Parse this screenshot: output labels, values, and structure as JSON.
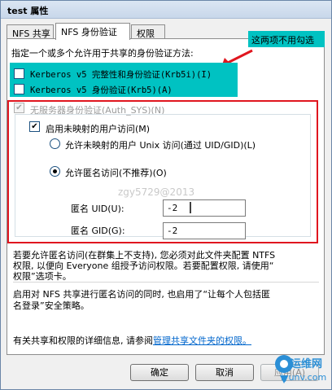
{
  "window": {
    "title": "test 属性"
  },
  "tabs": [
    {
      "label": "NFS 共享"
    },
    {
      "label": "NFS 身份验证"
    },
    {
      "label": "权限"
    }
  ],
  "auth": {
    "intro": "指定一个或多个允许用于共享的身份验证方法:",
    "krb5i_label": "Kerberos v5 完整性和身份验证(Krb5i)(I)",
    "krb5i_checked": false,
    "krb5_label": "Kerberos v5 身份验证(Krb5)(A)",
    "krb5_checked": false,
    "authsys_label": "无服务器身份验证(Auth_SYS)(N)",
    "authsys_checked": true,
    "unmapped_label": "启用未映射的用户访问(M)",
    "unmapped_checked": true,
    "radio_uid_label": "允许未映射的用户 Unix 访问(通过 UID/GID)(L)",
    "radio_anon_label": "允许匿名访问(不推荐)(O)",
    "selected_radio": "anon",
    "uid_label": "匿名 UID(U):",
    "uid_value": "-2",
    "gid_label": "匿名 GID(G):",
    "gid_value": "-2"
  },
  "annotation": {
    "callout_text": "这两项不用勾选",
    "highlight_color": "#00c2c2",
    "frame_color": "#e0161f"
  },
  "watermark": "zgy5729@2013",
  "notes": {
    "p1_l1": "若要允许匿名访问(在群集上不支持), 您必须对此文件夹配置 NTFS",
    "p1_l2": "权限, 以便向 Everyone 组授予访问权限。若要配置权限, 请使用“",
    "p1_l3": "权限”选项卡。",
    "p2_l1": "启用对 NFS 共享进行匿名访问的同时, 也启用了“让每个人包括匿",
    "p2_l2": "名登录”安全策略。",
    "info_prefix": "有关共享和权限的详细信息, 请参阅",
    "info_link": "管理共享文件夹的权限。"
  },
  "buttons": {
    "ok": "确定",
    "cancel": "取消",
    "apply": "应用(A)"
  },
  "logo": {
    "line1": "运维网",
    "line2": "iyunv.com"
  }
}
